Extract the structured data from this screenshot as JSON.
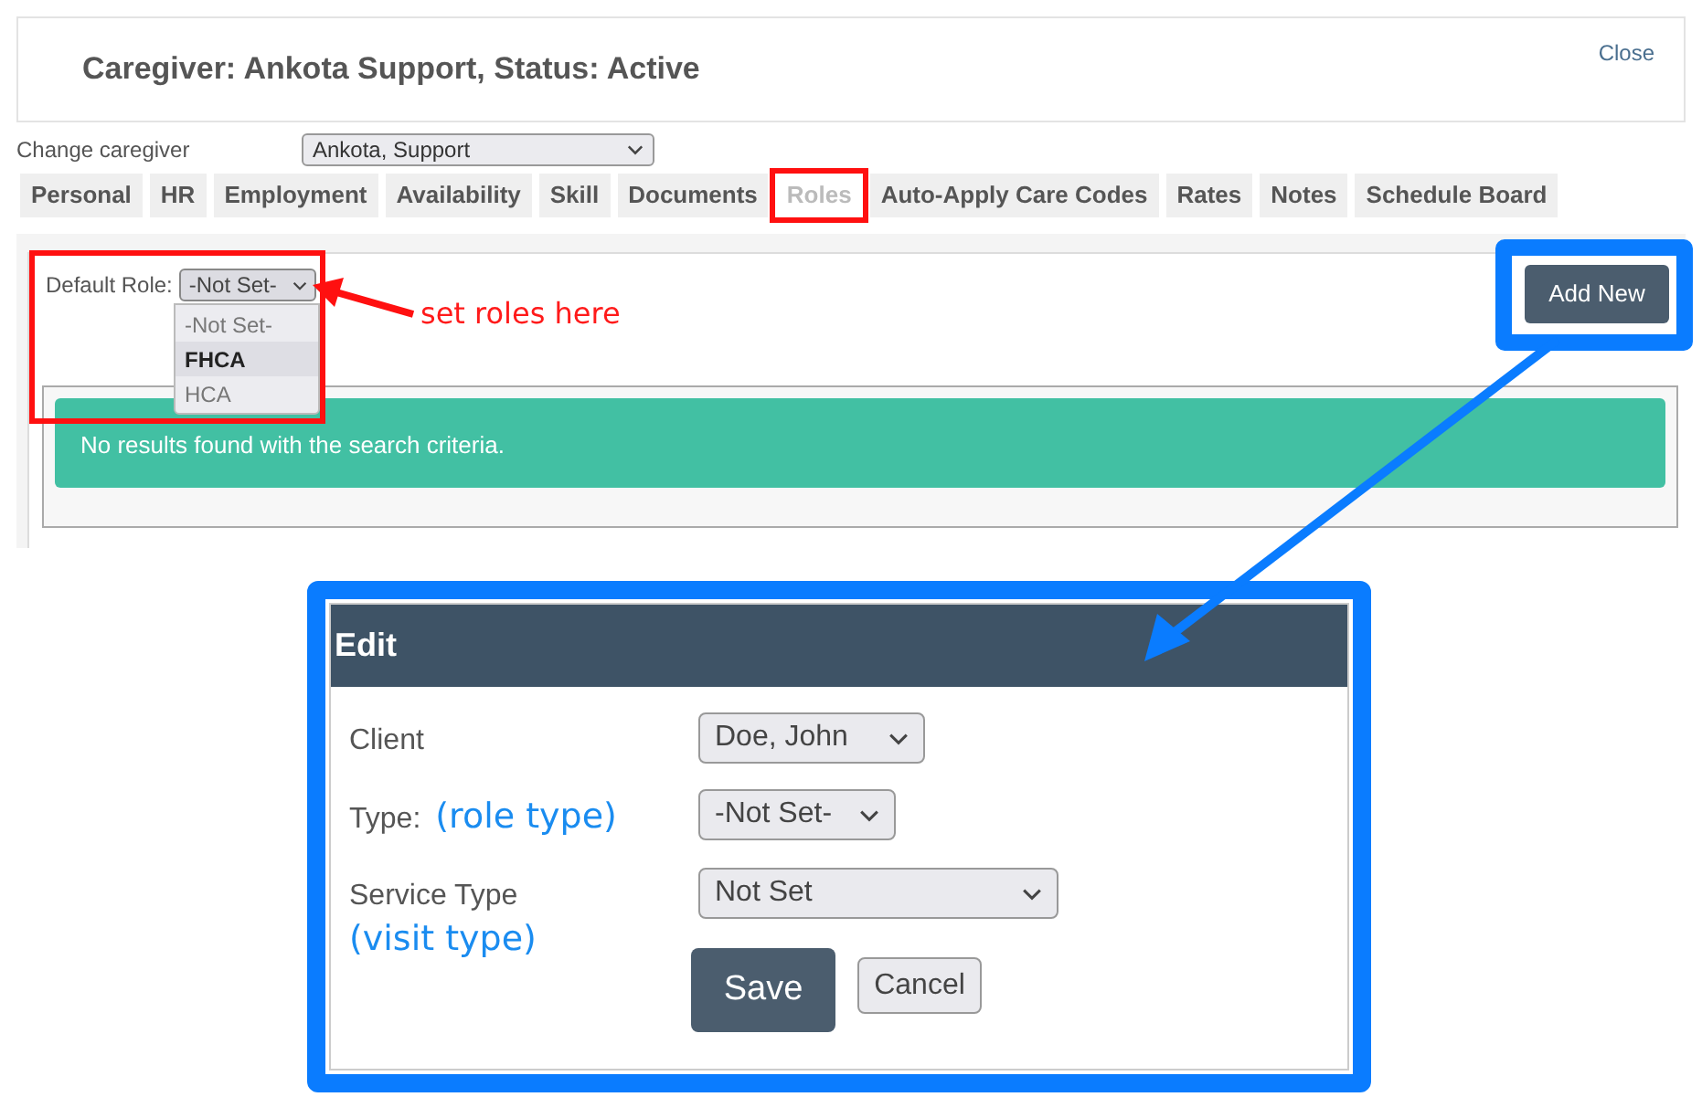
{
  "header": {
    "title": "Caregiver: Ankota Support, Status: Active",
    "close": "Close"
  },
  "caregiver_picker": {
    "label": "Change caregiver",
    "value": "Ankota, Support"
  },
  "tabs": [
    {
      "label": "Personal",
      "selected": false
    },
    {
      "label": "HR",
      "selected": false
    },
    {
      "label": "Employment",
      "selected": false
    },
    {
      "label": "Availability",
      "selected": false
    },
    {
      "label": "Skill",
      "selected": false
    },
    {
      "label": "Documents",
      "selected": false
    },
    {
      "label": "Roles",
      "selected": true
    },
    {
      "label": "Auto-Apply Care Codes",
      "selected": false
    },
    {
      "label": "Rates",
      "selected": false
    },
    {
      "label": "Notes",
      "selected": false
    },
    {
      "label": "Schedule Board",
      "selected": false
    }
  ],
  "roles_panel": {
    "default_role": {
      "label": "Default Role:",
      "value": "-Not Set-",
      "options": [
        {
          "label": "-Not Set-",
          "highlighted": false
        },
        {
          "label": "FHCA",
          "highlighted": true
        },
        {
          "label": "HCA",
          "highlighted": false
        }
      ]
    },
    "add_button": "Add New",
    "alert": "No results found with the search criteria."
  },
  "annotation": {
    "roles_note": "set roles here"
  },
  "edit_dialog": {
    "title": "Edit",
    "fields": [
      {
        "label": "Client",
        "value": "Doe, John"
      },
      {
        "label": "Type:",
        "note": "(role type)",
        "value": "-Not Set-"
      },
      {
        "label": "Service Type",
        "note": "(visit type)",
        "value": "Not Set"
      }
    ],
    "buttons": [
      {
        "label": "Save",
        "kind": "primary"
      },
      {
        "label": "Cancel",
        "kind": "secondary"
      }
    ]
  }
}
